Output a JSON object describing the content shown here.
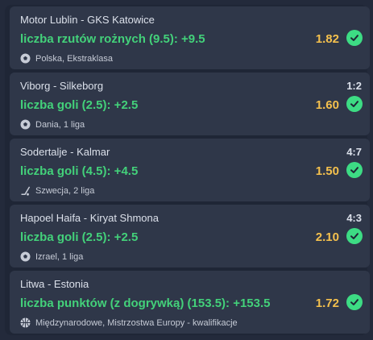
{
  "bets": [
    {
      "teams": "Motor Lublin - GKS Katowice",
      "score": "",
      "selection": "liczba rzutów rożnych (9.5): +9.5",
      "odds": "1.82",
      "league": "Polska, Ekstraklasa",
      "sport_icon": "soccer-ball-icon"
    },
    {
      "teams": "Viborg - Silkeborg",
      "score": "1:2",
      "selection": "liczba goli (2.5): +2.5",
      "odds": "1.60",
      "league": "Dania, 1 liga",
      "sport_icon": "soccer-ball-icon"
    },
    {
      "teams": "Sodertalje - Kalmar",
      "score": "4:7",
      "selection": "liczba goli (4.5): +4.5",
      "odds": "1.50",
      "league": "Szwecja, 2 liga",
      "sport_icon": "hockey-stick-icon"
    },
    {
      "teams": "Hapoel Haifa - Kiryat Shmona",
      "score": "4:3",
      "selection": "liczba goli (2.5): +2.5",
      "odds": "2.10",
      "league": "Izrael, 1 liga",
      "sport_icon": "soccer-ball-icon"
    },
    {
      "teams": "Litwa - Estonia",
      "score": "",
      "selection": "liczba punktów (z dogrywką) (153.5): +153.5",
      "odds": "1.72",
      "league": "Międzynarodowe, Mistrzostwa Europy - kwalifikacje",
      "sport_icon": "basketball-icon"
    }
  ],
  "colors": {
    "selection": "#43d17a",
    "odds": "#f4c04d",
    "check": "#3ddc84",
    "card": "#2f3749",
    "background": "#1f2636"
  }
}
